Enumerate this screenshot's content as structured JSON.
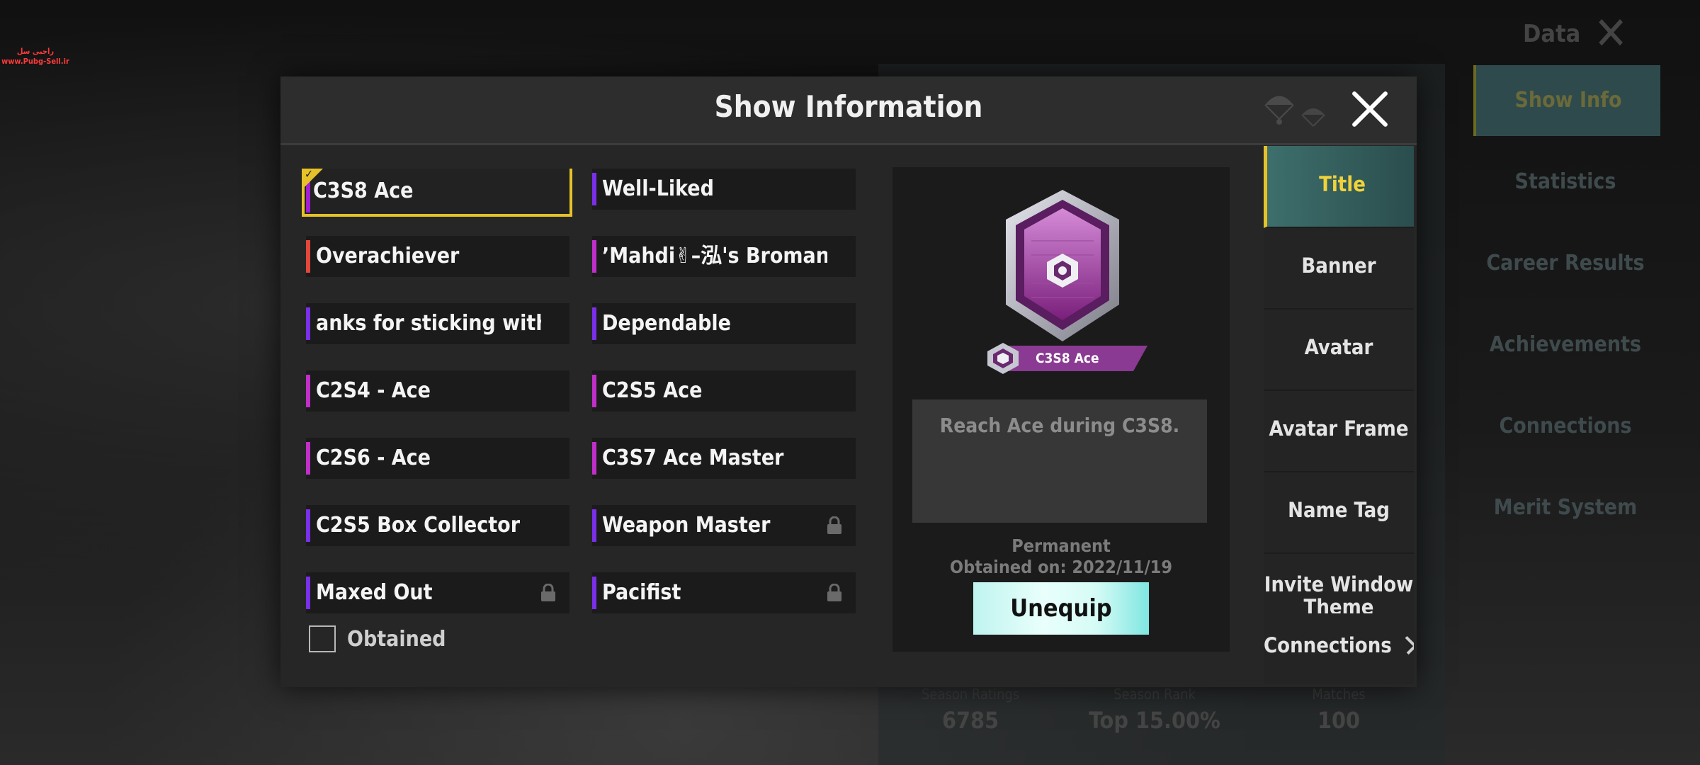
{
  "watermark": {
    "line1": "راجبی سل",
    "line2": "www.Pubg-Sell.ir"
  },
  "background": {
    "top_label": "Data",
    "tabs": [
      "Show Info",
      "Statistics",
      "Career Results",
      "Achievements",
      "Connections",
      "Merit System"
    ],
    "stats": [
      {
        "label": "Season Ratings",
        "value": "6785"
      },
      {
        "label": "Season Rank",
        "value": "Top 15.00%"
      },
      {
        "label": "Matches",
        "value": "100"
      }
    ]
  },
  "modal": {
    "title": "Show Information",
    "titles": [
      {
        "label": "C3S8 Ace",
        "bar": "#a31fd1",
        "selected": true
      },
      {
        "label": "Well-Liked",
        "bar": "#7a2fe8"
      },
      {
        "label": "Overachiever",
        "bar": "#e2483a"
      },
      {
        "label": "’Mahdi✌–泓's Bromance",
        "bar": "#c02fc8"
      },
      {
        "label": "anks for sticking with us!",
        "bar": "#7a2fe8"
      },
      {
        "label": "Dependable",
        "bar": "#7a2fe8"
      },
      {
        "label": "C2S4 - Ace",
        "bar": "#c02fc8"
      },
      {
        "label": "C2S5 Ace",
        "bar": "#c02fc8"
      },
      {
        "label": "C2S6 - Ace",
        "bar": "#c02fc8"
      },
      {
        "label": "C3S7 Ace Master",
        "bar": "#c02fc8"
      },
      {
        "label": "C2S5 Box Collector",
        "bar": "#7a2fe8"
      },
      {
        "label": "Weapon Master",
        "bar": "#7a2fe8",
        "locked": true
      },
      {
        "label": "Maxed Out",
        "bar": "#7a2fe8",
        "locked": true
      },
      {
        "label": "Pacifist",
        "bar": "#7a2fe8",
        "locked": true
      }
    ],
    "filter_label": "Obtained",
    "detail": {
      "name": "C3S8 Ace",
      "description": "Reach Ace during C3S8.",
      "duration": "Permanent",
      "obtained": "Obtained on: 2022/11/19",
      "button": "Unequip"
    },
    "tabs": [
      "Title",
      "Banner",
      "Avatar",
      "Avatar Frame",
      "Name Tag",
      "Invite Window Theme"
    ],
    "more_label": "Connections"
  }
}
